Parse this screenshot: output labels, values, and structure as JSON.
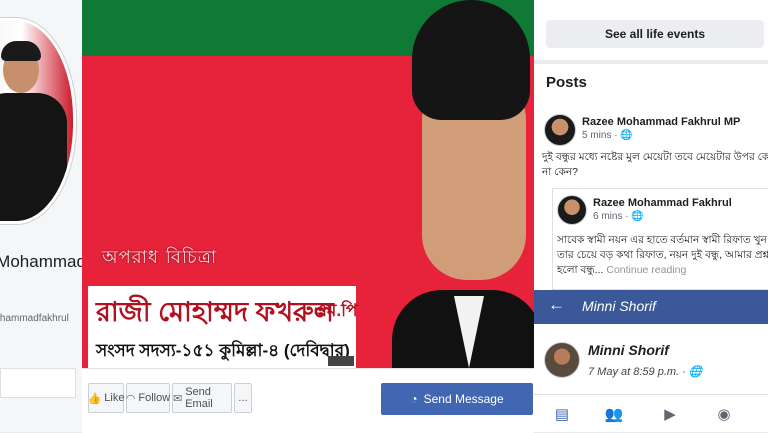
{
  "profile": {
    "name": "e Mohammad\nul",
    "handle": "mohammadfakhrul"
  },
  "cover": {
    "watermark": "অপরাধ বিচিত্রা",
    "nameplate_name": "রাজী মোহাম্মদ ফখরুল",
    "nameplate_suffix": "এম.পি",
    "nameplate_subtitle": "সংসদ সদস্য-১৫১ কুমিল্লা-৪ (দেবিদ্বার)"
  },
  "actions": {
    "like": "Like",
    "follow": "Follow",
    "send_email": "Send Email",
    "more": "...",
    "send_message": "Send Message"
  },
  "right": {
    "life_events_button": "See all life events",
    "posts_title": "Posts",
    "post1": {
      "author": "Razee Mohammad Fakhrul MP",
      "time": "5 mins · 🌐",
      "text": "দুই বন্ধুর মধ্যে নষ্টের মুল মেয়েটা  তবে মেয়েটার উপর কে না কেন?"
    },
    "post2": {
      "author": "Razee Mohammad Fakhrul",
      "time": "6 mins · 🌐",
      "text": "সাবেক স্বামী নয়ন এর হাতে বর্তমান স্বামী রিফাত খুন তার চেয়ে বড় কথা রিফাত, নয়ন দুই বন্ধু, আমার প্রশ্ন হলো বন্ধু...",
      "continue": "Continue reading"
    },
    "chat": {
      "back": "←",
      "title": "Minni Shorif",
      "name": "Minni Shorif",
      "time": "7 May at 8:59 p.m. · 🌐"
    },
    "tabs": {
      "news": "▤",
      "friends": "👥",
      "watch": "▶",
      "groups": "◉"
    }
  }
}
